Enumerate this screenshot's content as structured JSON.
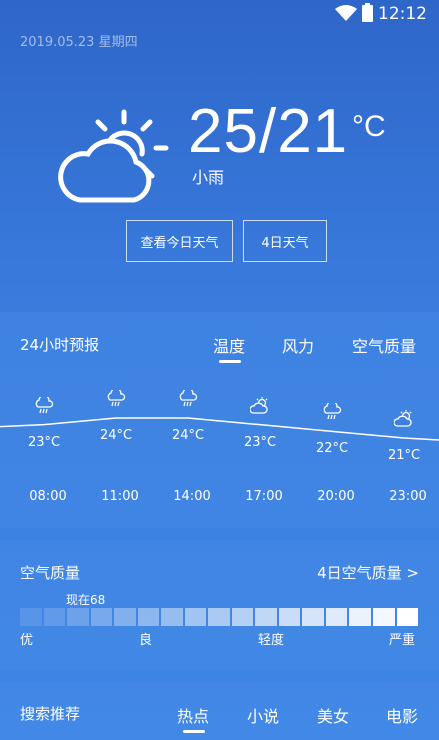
{
  "status": {
    "time": "12:12"
  },
  "date": "2019.05.23 星期四",
  "current": {
    "temp": "25/21",
    "unit": "°C",
    "condition": "小雨",
    "icon": "partly-cloudy-icon"
  },
  "buttons": {
    "today": "查看今日天气",
    "four_day": "4日天气"
  },
  "forecast": {
    "title": "24小时预报",
    "tabs": [
      "温度",
      "风力",
      "空气质量"
    ],
    "hours": [
      {
        "temp": "23°C",
        "time": "08:00",
        "icon": "rain-icon"
      },
      {
        "temp": "24°C",
        "time": "11:00",
        "icon": "rain-icon"
      },
      {
        "temp": "24°C",
        "time": "14:00",
        "icon": "rain-icon"
      },
      {
        "temp": "23°C",
        "time": "17:00",
        "icon": "sun-cloud-icon"
      },
      {
        "temp": "22°C",
        "time": "20:00",
        "icon": "rain-icon"
      },
      {
        "temp": "21°C",
        "time": "23:00",
        "icon": "sun-cloud-icon"
      }
    ]
  },
  "chart_data": {
    "type": "line",
    "x": [
      "08:00",
      "11:00",
      "14:00",
      "17:00",
      "20:00",
      "23:00"
    ],
    "series": [
      {
        "values": [
          23,
          24,
          24,
          23,
          22,
          21
        ]
      }
    ]
  },
  "air": {
    "title": "空气质量",
    "link": "4日空气质量 >",
    "now": "现在68",
    "level": 68,
    "labels": [
      "优",
      "良",
      "轻度",
      "严重"
    ]
  },
  "search": {
    "title": "搜索推荐",
    "tabs": [
      "热点",
      "小说",
      "美女",
      "电影"
    ]
  }
}
